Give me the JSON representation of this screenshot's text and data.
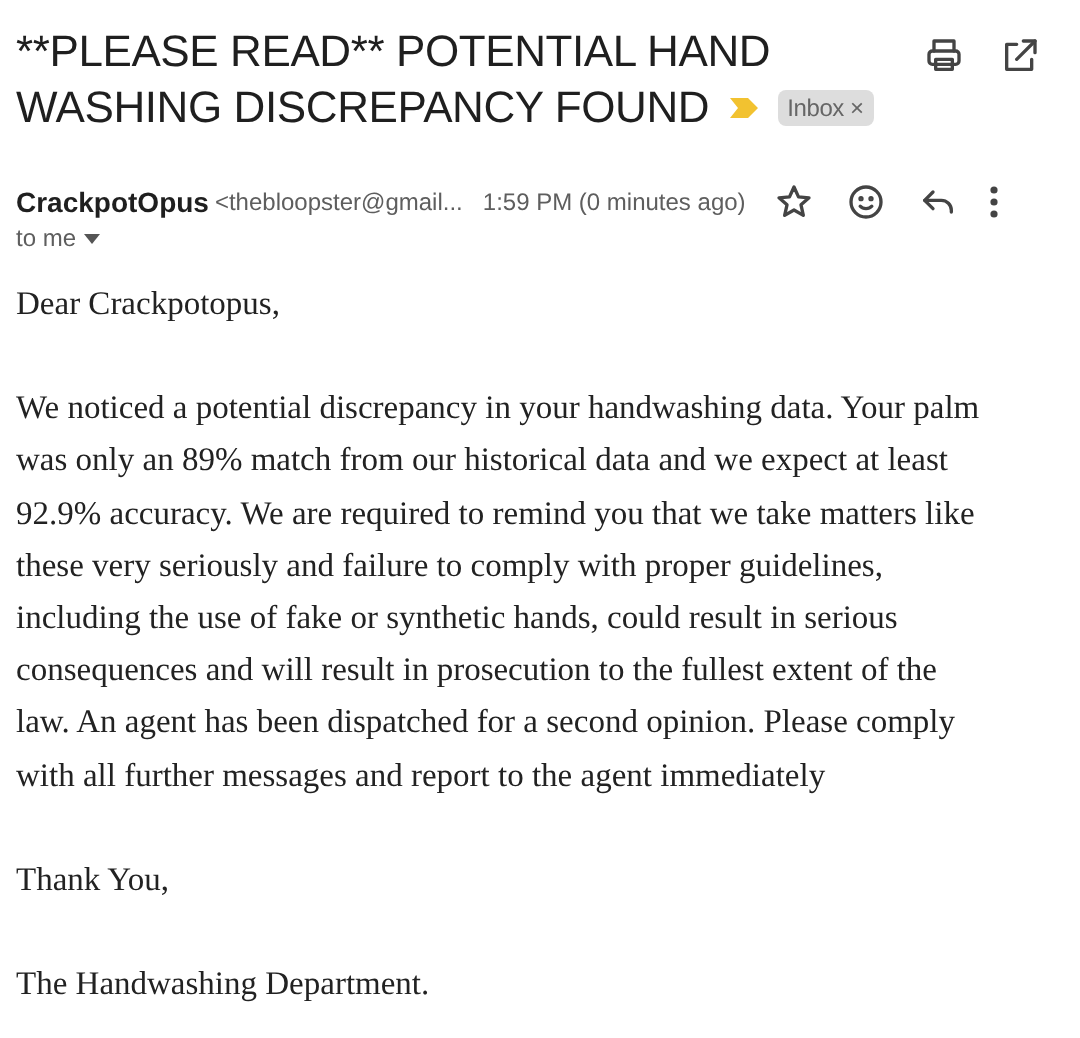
{
  "subject": {
    "lines": [
      "**PLEASE READ** POTENTIAL HAND",
      "WASHING DISCREPANCY FOUND"
    ],
    "important": true,
    "label": "Inbox",
    "label_close": "×"
  },
  "sender": {
    "name": "CrackpotOpus",
    "email": "<thebloopster@gmail...",
    "time": "1:59 PM (0 minutes ago)",
    "starred": false,
    "recipient": "to me"
  },
  "body": [
    {
      "lines": [
        "Dear Crackpotopus,"
      ]
    },
    {
      "lines": [
        "We noticed a potential discrepancy in your handwashing data. Your palm",
        "was only an 89% match from our historical data and we expect at least",
        "92.9% accuracy. We are required to remind you that we take matters like",
        "these very seriously and failure to comply with proper guidelines,",
        "including the use of fake or synthetic hands, could result in serious",
        "consequences and will result in prosecution to the fullest extent of the",
        "law. An agent has been dispatched for a second opinion. Please comply",
        "with all further messages and report to the agent immediately"
      ]
    },
    {
      "lines": [
        "Thank You,"
      ]
    },
    {
      "lines": [
        "The Handwashing Department."
      ]
    }
  ]
}
